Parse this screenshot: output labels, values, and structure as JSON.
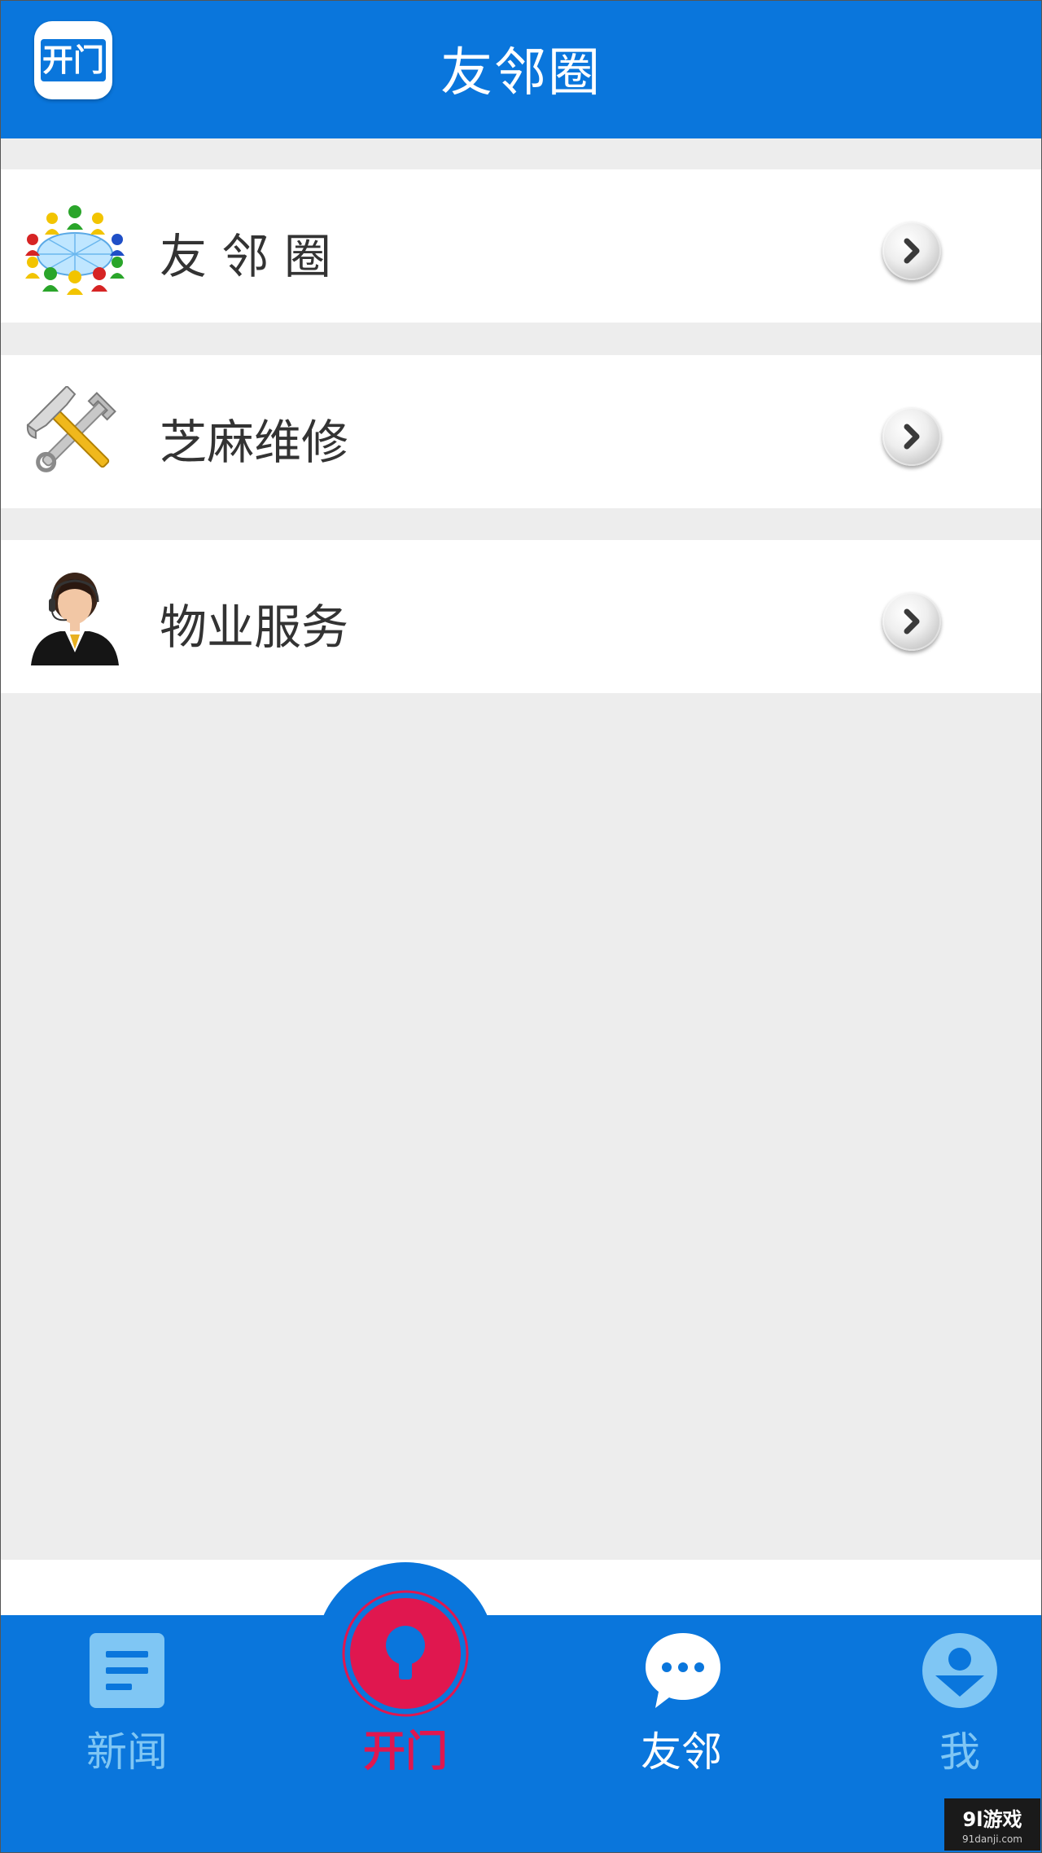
{
  "header": {
    "title": "友邻圈",
    "open_button_label": "开门"
  },
  "menu": {
    "items": [
      {
        "label": "友 邻 圈",
        "icon": "community-network-icon"
      },
      {
        "label": "芝麻维修",
        "icon": "repair-tools-icon"
      },
      {
        "label": "物业服务",
        "icon": "customer-service-icon"
      }
    ]
  },
  "tabbar": {
    "tabs": [
      {
        "label": "新闻",
        "icon": "news-icon",
        "state": "inactive"
      },
      {
        "label": "开门",
        "icon": "door-unlock-icon",
        "state": "active"
      },
      {
        "label": "友邻",
        "icon": "chat-bubble-icon",
        "state": "selected"
      },
      {
        "label": "我",
        "icon": "profile-icon",
        "state": "inactive"
      }
    ]
  },
  "colors": {
    "primary_blue": "#0a76dc",
    "light_blue": "#7fc6f4",
    "accent_red": "#e0174f",
    "background": "#ededed"
  },
  "watermark": {
    "main": "9l游戏",
    "sub": "91danji.com"
  }
}
